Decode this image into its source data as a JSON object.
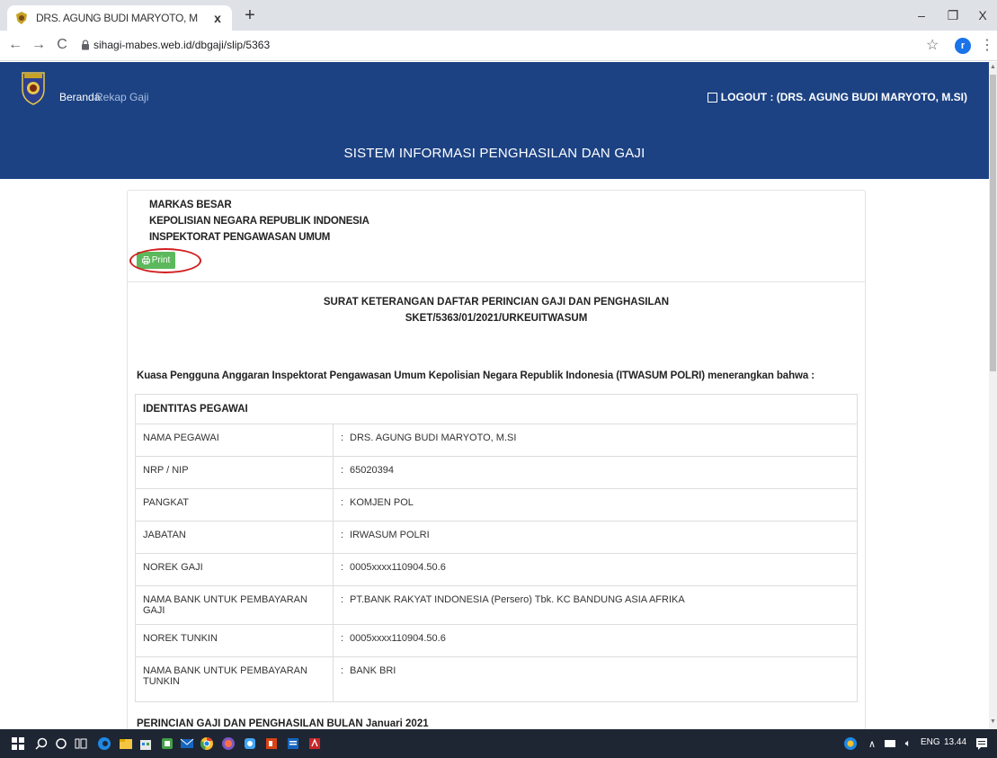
{
  "browser": {
    "tab_title": "DRS. AGUNG BUDI MARYOTO, M",
    "tab_close": "x",
    "new_tab": "+",
    "url": "sihagi-mabes.web.id/dbgaji/slip/5363",
    "profile_initial": "r",
    "window_controls": [
      "–",
      "❐",
      "X"
    ]
  },
  "navbar": {
    "home": "Beranda",
    "rekap": "Rekap Gaji",
    "logout": "LOGOUT : (DRS. AGUNG BUDI MARYOTO, M.SI)",
    "site_title": "SISTEM INFORMASI PENGHASILAN DAN GAJI",
    "color": "#1c4283"
  },
  "header": {
    "org_line1": "MARKAS BESAR",
    "org_line2": "KEPOLISIAN NEGARA REPUBLIK INDONESIA",
    "org_line3": "INSPEKTORAT PENGAWASAN UMUM",
    "print_label": "Print"
  },
  "document": {
    "title": "SURAT KETERANGAN DAFTAR PERINCIAN GAJI DAN PENGHASILAN",
    "number": "SKET/5363/01/2021/URKEUITWASUM",
    "intro": "Kuasa Pengguna Anggaran Inspektorat Pengawasan Umum Kepolisian Negara Republik Indonesia (ITWASUM POLRI) menerangkan bahwa :",
    "identity_heading": "IDENTITAS PEGAWAI",
    "identity_rows": [
      {
        "label": "NAMA PEGAWAI",
        "value": "DRS. AGUNG BUDI MARYOTO, M.SI"
      },
      {
        "label": "NRP / NIP",
        "value": "65020394"
      },
      {
        "label": "PANGKAT",
        "value": "KOMJEN POL"
      },
      {
        "label": "JABATAN",
        "value": "IRWASUM POLRI"
      },
      {
        "label": "NOREK GAJI",
        "value": "0005xxxx110904.50.6"
      },
      {
        "label": "NAMA BANK UNTUK PEMBAYARAN GAJI",
        "value": "PT.BANK RAKYAT INDONESIA (Persero) Tbk. KC BANDUNG ASIA AFRIKA"
      },
      {
        "label": "NOREK TUNKIN",
        "value": "0005xxxx110904.50.6"
      },
      {
        "label": "NAMA BANK UNTUK PEMBAYARAN TUNKIN",
        "value": "BANK BRI"
      }
    ],
    "colon": ":",
    "section2_title": "PERINCIAN GAJI DAN PENGHASILAN BULAN Januari 2021"
  },
  "taskbar": {
    "language": "ENG",
    "time": "13.44"
  },
  "colors": {
    "print_button": "#5cb85c",
    "highlight_circle": "#d21f1f",
    "taskbar": "#1f2633"
  }
}
